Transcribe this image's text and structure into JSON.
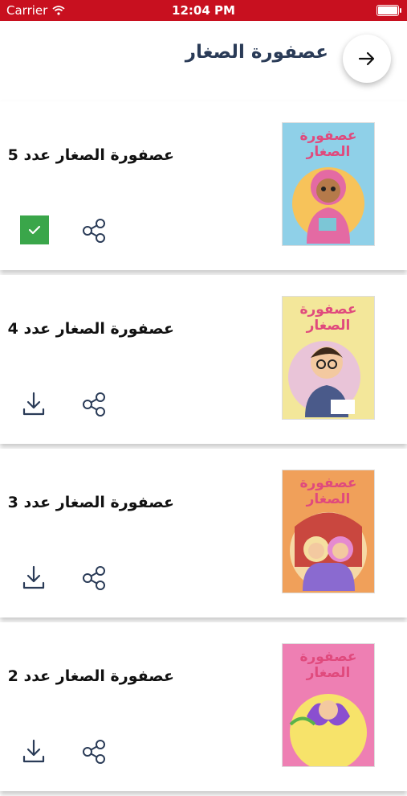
{
  "status_bar": {
    "carrier": "Carrier",
    "time": "12:04 PM"
  },
  "header": {
    "title": "عصفورة الصغار",
    "back_icon": "arrow-right-icon"
  },
  "cover_title": "عصفورة الصغار",
  "issues": [
    {
      "title": "عصفورة الصغار عدد 5",
      "state": "downloaded",
      "cover_bg": "#8fd0e8"
    },
    {
      "title": "عصفورة الصغار عدد 4",
      "state": "download",
      "cover_bg": "#f3e79a"
    },
    {
      "title": "عصفورة الصغار عدد 3",
      "state": "download",
      "cover_bg": "#f0a05a"
    },
    {
      "title": "عصفورة الصغار عدد 2",
      "state": "download",
      "cover_bg": "#ee7fb3"
    }
  ],
  "colors": {
    "status_bar": "#c8101f",
    "title_text": "#2a3b57",
    "downloaded_badge": "#3aa64a",
    "icon_stroke": "#2a3b57"
  }
}
